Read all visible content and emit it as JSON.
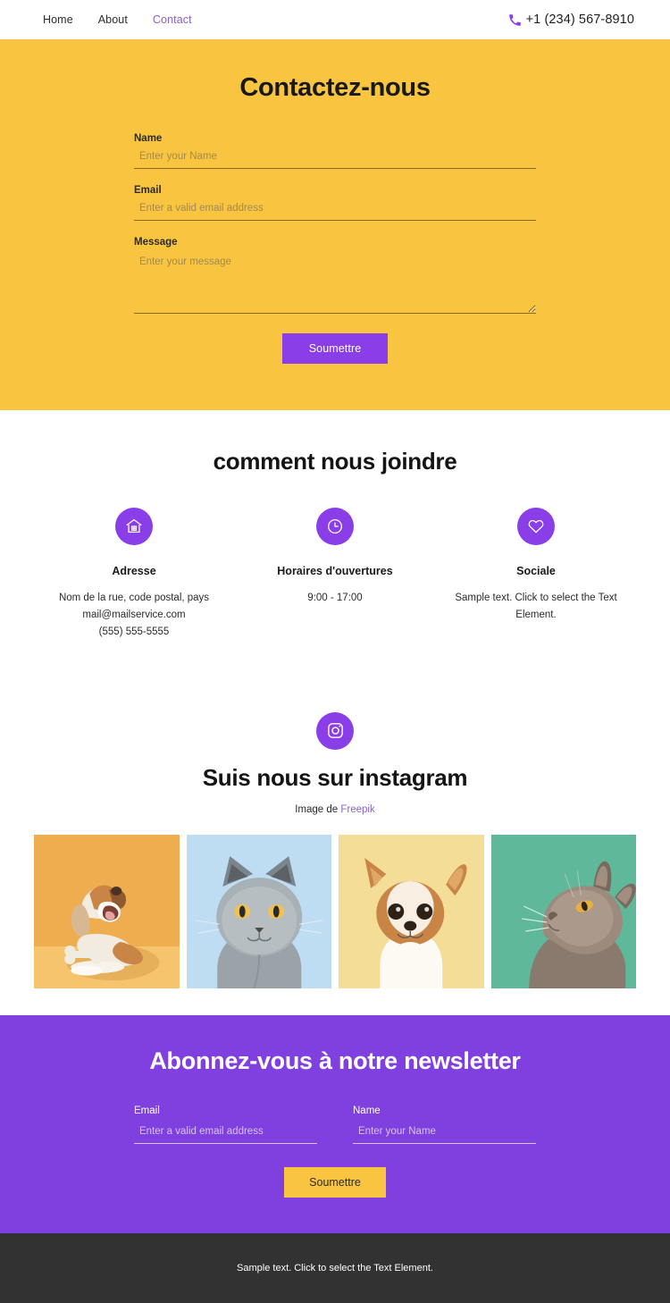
{
  "header": {
    "nav": [
      {
        "label": "Home",
        "active": false
      },
      {
        "label": "About",
        "active": false
      },
      {
        "label": "Contact",
        "active": true
      }
    ],
    "phone": "+1 (234) 567-8910",
    "phone_icon": "phone-icon"
  },
  "contact": {
    "title": "Contactez-nous",
    "fields": {
      "name_label": "Name",
      "name_placeholder": "Enter your Name",
      "name_value": "",
      "email_label": "Email",
      "email_placeholder": "Enter a valid email address",
      "email_value": "",
      "message_label": "Message",
      "message_placeholder": "Enter your message",
      "message_value": ""
    },
    "submit_label": "Soumettre"
  },
  "reach": {
    "title": "comment nous joindre",
    "columns": [
      {
        "icon": "house-icon",
        "heading": "Adresse",
        "lines": [
          "Nom de la rue, code postal, pays",
          "mail@mailservice.com",
          "(555) 555-5555"
        ]
      },
      {
        "icon": "clock-icon",
        "heading": "Horaires d'ouvertures",
        "lines": [
          "9:00 - 17:00"
        ]
      },
      {
        "icon": "heart-icon",
        "heading": "Sociale",
        "lines": [
          "Sample text. Click to select the Text Element."
        ]
      }
    ]
  },
  "instagram": {
    "icon": "instagram-icon",
    "title": "Suis nous sur instagram",
    "credit_prefix": "Image de ",
    "credit_link": "Freepik",
    "gallery": [
      {
        "alt": "beagle-dog-on-orange-background",
        "bg": "#eeae4f",
        "floor": "#f6c46c"
      },
      {
        "alt": "grey-british-shorthair-cat-on-blue-background",
        "bg": "#bedcf2",
        "floor": "#bedcf2"
      },
      {
        "alt": "chihuahua-dog-on-pale-yellow-background",
        "bg": "#f3dd97",
        "floor": "#f3dd97"
      },
      {
        "alt": "brown-cat-looking-up-on-teal-background",
        "bg": "#5fb89a",
        "floor": "#5fb89a"
      }
    ]
  },
  "newsletter": {
    "title": "Abonnez-vous à notre newsletter",
    "email_label": "Email",
    "email_placeholder": "Enter a valid email address",
    "email_value": "",
    "name_label": "Name",
    "name_placeholder": "Enter your Name",
    "name_value": "",
    "submit_label": "Soumettre"
  },
  "footer": {
    "text": "Sample text. Click to select the Text Element."
  },
  "colors": {
    "yellow": "#f9c440",
    "purple": "#8a3ee8",
    "newsletter_purple": "#8040e0",
    "footer_dark": "#323232",
    "link_purple": "#8b5fd6"
  }
}
